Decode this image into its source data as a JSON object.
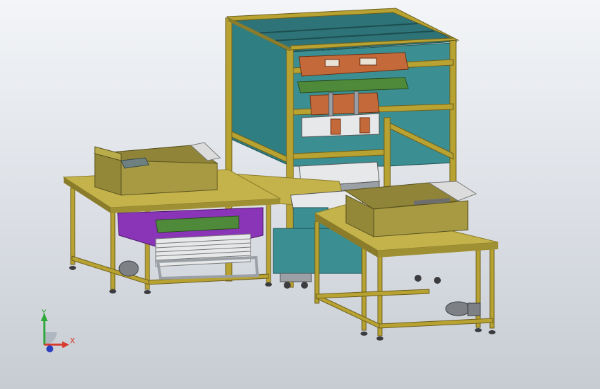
{
  "viewport": {
    "background_top": "#f3f5f8",
    "background_bottom": "#c7ccd3"
  },
  "colors": {
    "frame": "#b8a232",
    "frame_dark": "#6e601c",
    "panel": "#2f7f82",
    "panel_dark": "#1f5d60",
    "box": "#a79a42",
    "box_dark": "#7a7030",
    "roller": "#c4b24a",
    "roller_dark": "#8a7c2a",
    "purple": "#8a35b8",
    "orange": "#c46a3a",
    "green_plate": "#4f8a3a",
    "grey": "#7d8186",
    "foot": "#3a3c40"
  },
  "triad": {
    "x_label": "X",
    "y_label": "Y",
    "x_color": "#d83a2e",
    "y_color": "#2fa93a",
    "z_color": "#2a3fbf"
  }
}
